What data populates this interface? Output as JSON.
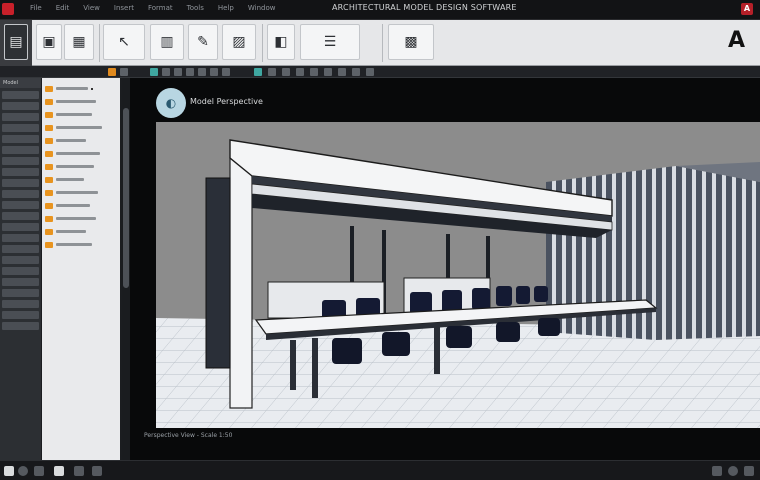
{
  "window": {
    "title": "ARCHITECTURAL MODEL DESIGN SOFTWARE",
    "brand_letter": "A"
  },
  "menu": [
    "File",
    "Edit",
    "View",
    "Insert",
    "Format",
    "Tools",
    "Help",
    "Window"
  ],
  "ribbon": {
    "buttons": [
      {
        "icon": "document-icon",
        "glyph": "▤"
      },
      {
        "icon": "save-icon",
        "glyph": "▣"
      },
      {
        "icon": "table-icon",
        "glyph": "▦"
      },
      {
        "icon": "cursor-icon",
        "glyph": "↖"
      },
      {
        "icon": "component-icon",
        "glyph": "▥"
      },
      {
        "icon": "measure-icon",
        "glyph": "✎"
      },
      {
        "icon": "render-icon",
        "glyph": "▨"
      },
      {
        "icon": "camera-icon",
        "glyph": "◧"
      },
      {
        "icon": "layers-icon",
        "glyph": "☰"
      },
      {
        "icon": "export-icon",
        "glyph": "▩"
      }
    ]
  },
  "left_nav": {
    "header": "Model"
  },
  "viewport": {
    "view_name": "Model Perspective",
    "footer": "Perspective View - Scale 1:50"
  },
  "colors": {
    "accent": "#c8202a",
    "folder": "#e8941f",
    "ribbon_bg": "#e6e7e9"
  }
}
